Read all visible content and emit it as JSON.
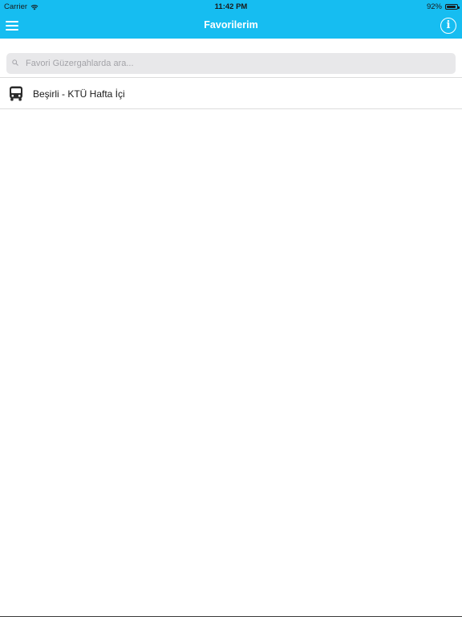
{
  "status_bar": {
    "carrier": "Carrier",
    "time": "11:42 PM",
    "battery": "92%",
    "battery_level": 0.92
  },
  "nav": {
    "title": "Favorilerim",
    "menu_icon": "hamburger-menu-icon",
    "info_icon": "info-icon",
    "info_glyph": "i"
  },
  "search": {
    "placeholder": "Favori Güzergahlarda ara...",
    "value": "",
    "icon": "search-icon"
  },
  "favorites": [
    {
      "label": "Beşirli - KTÜ Hafta İçi",
      "icon": "bus-icon"
    }
  ],
  "colors": {
    "nav_bar": "#16bdf1",
    "search_field": "#e8e8ea"
  }
}
